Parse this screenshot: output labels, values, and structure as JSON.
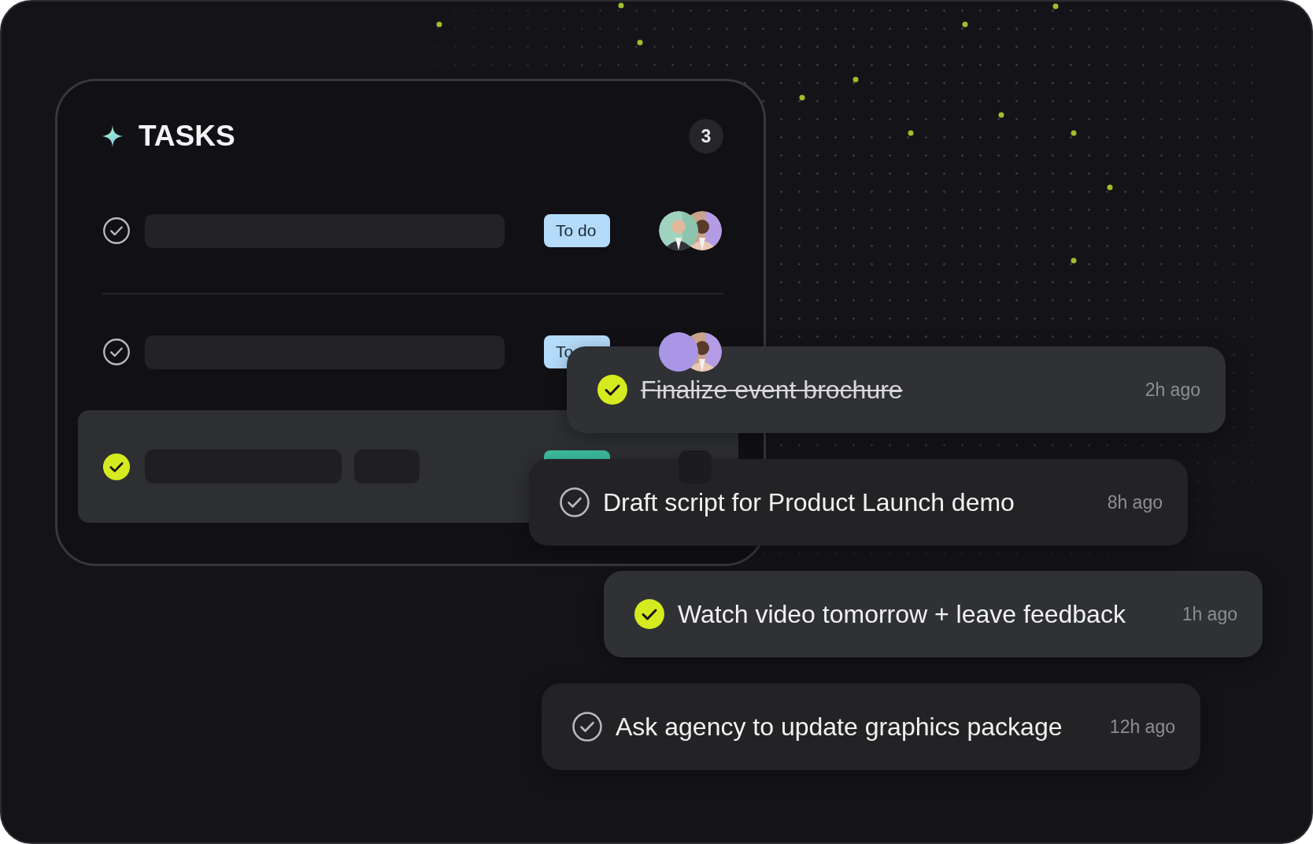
{
  "tasks_panel": {
    "title": "TASKS",
    "count": "3",
    "rows": [
      {
        "selected": false,
        "checked": false,
        "placeholders": [
          {
            "kind": "long"
          }
        ],
        "tag": {
          "label": "To do",
          "color": "#b4dcfa"
        },
        "avatars": [
          {
            "kind": "picture"
          },
          {
            "kind": "picture"
          }
        ]
      },
      {
        "selected": false,
        "checked": false,
        "placeholders": [
          {
            "kind": "long"
          }
        ],
        "tag": {
          "label": "To",
          "color": "#b4dcfa"
        },
        "avatars": [
          {
            "kind": "initial"
          },
          {
            "kind": "picture"
          }
        ]
      },
      {
        "selected": true,
        "checked": true,
        "placeholders": [
          {
            "kind": "medium"
          },
          {
            "kind": "short"
          }
        ],
        "tag": {
          "color": "#3dbf9f"
        },
        "avatars": [
          {
            "kind": "blank"
          }
        ]
      }
    ]
  },
  "notifications": [
    {
      "text": "Finalize event brochure",
      "time": "2h ago",
      "checked": true,
      "struck": true
    },
    {
      "text": "Draft script for Product Launch demo",
      "time": "8h ago",
      "checked": false,
      "struck": false
    },
    {
      "text": "Watch video tomorrow + leave feedback",
      "time": "1h ago",
      "checked": true,
      "struck": false
    },
    {
      "text": "Ask agency to update graphics package",
      "time": "12h ago",
      "checked": false,
      "struck": false
    }
  ]
}
